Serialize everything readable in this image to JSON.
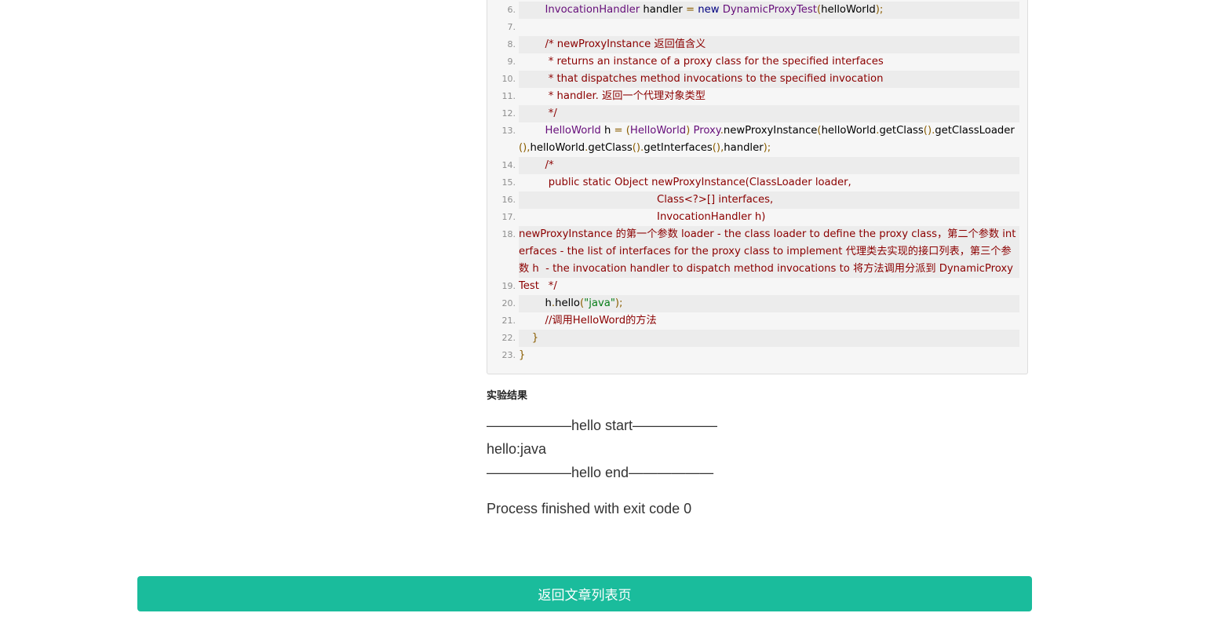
{
  "code": {
    "lines": [
      {
        "num": "6.",
        "tokens": [
          {
            "t": "        "
          },
          {
            "t": "InvocationHandler",
            "c": "type"
          },
          {
            "t": " handler "
          },
          {
            "t": "=",
            "c": "pn"
          },
          {
            "t": " "
          },
          {
            "t": "new",
            "c": "kw"
          },
          {
            "t": " "
          },
          {
            "t": "DynamicProxyTest",
            "c": "type"
          },
          {
            "t": "(",
            "c": "pn"
          },
          {
            "t": "helloWorld"
          },
          {
            "t": ");",
            "c": "pn"
          }
        ]
      },
      {
        "num": "7.",
        "tokens": []
      },
      {
        "num": "8.",
        "tokens": [
          {
            "t": "        /* newProxyInstance 返回值含义",
            "c": "cm"
          }
        ]
      },
      {
        "num": "9.",
        "tokens": [
          {
            "t": "         * returns an instance of a proxy class for the specified interfaces",
            "c": "cm"
          }
        ]
      },
      {
        "num": "10.",
        "tokens": [
          {
            "t": "         * that dispatches method invocations to the specified invocation",
            "c": "cm"
          }
        ]
      },
      {
        "num": "11.",
        "tokens": [
          {
            "t": "         * handler. 返回一个代理对象类型",
            "c": "cm"
          }
        ]
      },
      {
        "num": "12.",
        "tokens": [
          {
            "t": "         */",
            "c": "cm"
          }
        ]
      },
      {
        "num": "13.",
        "tokens": [
          {
            "t": "        "
          },
          {
            "t": "HelloWorld",
            "c": "type"
          },
          {
            "t": " h "
          },
          {
            "t": "= (",
            "c": "pn"
          },
          {
            "t": "HelloWorld",
            "c": "type"
          },
          {
            "t": ") ",
            "c": "pn"
          },
          {
            "t": "Proxy",
            "c": "type"
          },
          {
            "t": ".",
            "c": "pn"
          },
          {
            "t": "newProxyInstance"
          },
          {
            "t": "(",
            "c": "pn"
          },
          {
            "t": "helloWorld"
          },
          {
            "t": ".",
            "c": "pn"
          },
          {
            "t": "getClass"
          },
          {
            "t": "().",
            "c": "pn"
          },
          {
            "t": "getClassLoader"
          },
          {
            "t": "(),",
            "c": "pn"
          },
          {
            "t": "helloWorld"
          },
          {
            "t": ".",
            "c": "pn"
          },
          {
            "t": "getClass"
          },
          {
            "t": "().",
            "c": "pn"
          },
          {
            "t": "getInterfaces"
          },
          {
            "t": "(),",
            "c": "pn"
          },
          {
            "t": "handler"
          },
          {
            "t": ");",
            "c": "pn"
          }
        ]
      },
      {
        "num": "14.",
        "tokens": [
          {
            "t": "        /*",
            "c": "cm"
          }
        ]
      },
      {
        "num": "15.",
        "tokens": [
          {
            "t": "         public static Object newProxyInstance(ClassLoader loader,",
            "c": "cm"
          }
        ]
      },
      {
        "num": "16.",
        "tokens": [
          {
            "t": "                                          Class<?>[] interfaces,",
            "c": "cm"
          }
        ]
      },
      {
        "num": "17.",
        "tokens": [
          {
            "t": "                                          InvocationHandler h)",
            "c": "cm"
          }
        ]
      },
      {
        "num": "18.",
        "tokens": [
          {
            "t": "newProxyInstance 的第一个参数 loader - the class loader to define the proxy class，第二个参数 interfaces - the list of interfaces for the proxy class to implement 代理类去实现的接口列表，第三个参数 h  - the invocation handler to dispatch method invocations to 将方法调用分派到 DynamicProxyTest",
            "c": "cm"
          }
        ]
      },
      {
        "num": "19.",
        "tokens": [
          {
            "t": "         */",
            "c": "cm"
          }
        ]
      },
      {
        "num": "20.",
        "tokens": [
          {
            "t": "        h"
          },
          {
            "t": ".",
            "c": "pn"
          },
          {
            "t": "hello"
          },
          {
            "t": "(",
            "c": "pn"
          },
          {
            "t": "\"java\"",
            "c": "str"
          },
          {
            "t": ");",
            "c": "pn"
          }
        ]
      },
      {
        "num": "21.",
        "tokens": [
          {
            "t": "        //调用HelloWord的方法",
            "c": "cm"
          }
        ]
      },
      {
        "num": "22.",
        "tokens": [
          {
            "t": "    "
          },
          {
            "t": "}",
            "c": "pn"
          }
        ]
      },
      {
        "num": "23.",
        "tokens": [
          {
            "t": "}",
            "c": "pn"
          }
        ]
      }
    ]
  },
  "result": {
    "heading": "实验结果",
    "lines": [
      "——————hello start——————",
      "hello:java",
      "——————hello end——————",
      "Process finished with exit code 0"
    ]
  },
  "footer": {
    "back_button": "返回文章列表页"
  },
  "colors": {
    "button": "#1abc9c",
    "code_background": "#f6f6f6",
    "code_alt_row": "#ececec",
    "comment": "#8b0000",
    "type": "#660e7a",
    "keyword": "#000080",
    "string": "#067d17"
  }
}
